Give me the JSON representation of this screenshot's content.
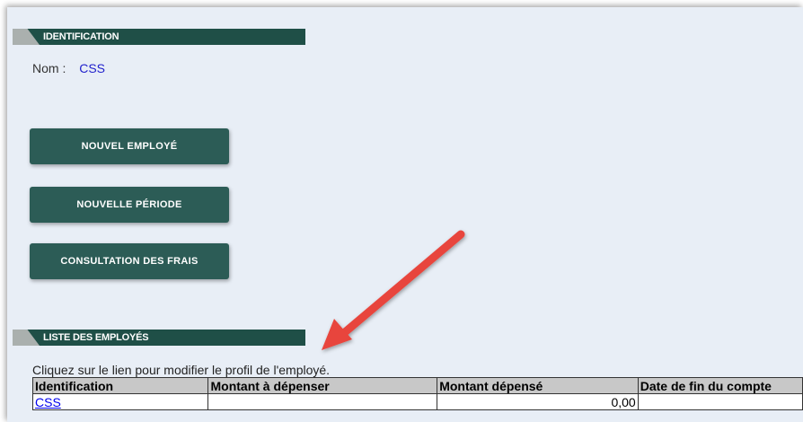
{
  "identification": {
    "header": "IDENTIFICATION",
    "nom_label": "Nom :",
    "nom_value": "CSS"
  },
  "buttons": {
    "nouvel_employe": "NOUVEL EMPLOYÉ",
    "nouvelle_periode": "NOUVELLE PÉRIODE",
    "consultation_frais": "CONSULTATION DES FRAIS"
  },
  "liste": {
    "header": "LISTE DES EMPLOYÉS",
    "hint": "Cliquez sur le lien pour modifier le profil de l'employé.",
    "columns": [
      "Identification",
      "Montant à dépenser",
      "Montant dépensé",
      "Date de fin du compte"
    ],
    "rows": [
      {
        "identification": "CSS",
        "montant_a_depenser": "",
        "montant_depense": "0,00",
        "date_fin": ""
      }
    ]
  },
  "annotation": {
    "arrow_color": "#e8453c"
  },
  "colors": {
    "header_bg": "#1f4f47",
    "button_bg": "#2c5c56",
    "page_bg": "#e8eef6"
  }
}
